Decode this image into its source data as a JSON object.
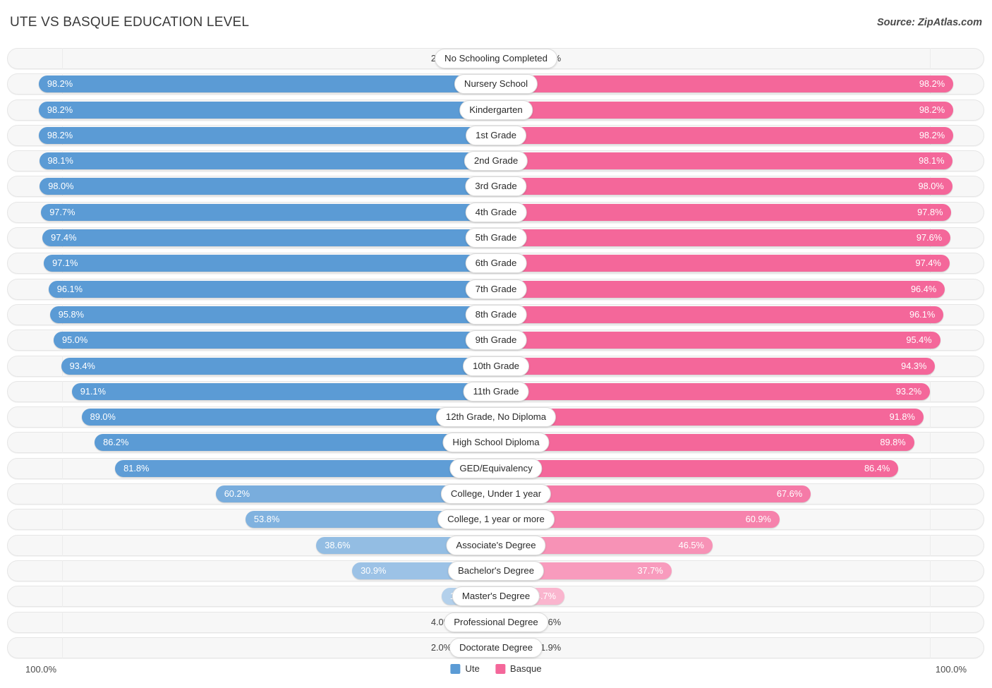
{
  "header": {
    "title": "UTE VS BASQUE EDUCATION LEVEL",
    "source": "Source: ZipAtlas.com"
  },
  "footer": {
    "axis_left": "100.0%",
    "axis_right": "100.0%",
    "legend": [
      {
        "label": "Ute",
        "color": "#5b9bd5"
      },
      {
        "label": "Basque",
        "color": "#f4679a"
      }
    ]
  },
  "colors": {
    "ute_strong": "#5b9bd5",
    "ute_light": "#b0cdee",
    "basque_strong": "#f4679a",
    "basque_light": "#f8aec8",
    "track_bg": "#f7f7f7",
    "track_border": "#e6e6e6"
  },
  "chart_data": {
    "type": "bar",
    "title": "UTE VS BASQUE EDUCATION LEVEL",
    "subtitle": "Source: ZipAtlas.com",
    "orientation": "horizontal-diverging",
    "xlabel": "",
    "ylabel": "",
    "xlim": [
      0,
      100
    ],
    "axis_left_label": "100.0%",
    "axis_right_label": "100.0%",
    "grid": false,
    "legend_position": "bottom-center",
    "categories": [
      "No Schooling Completed",
      "Nursery School",
      "Kindergarten",
      "1st Grade",
      "2nd Grade",
      "3rd Grade",
      "4th Grade",
      "5th Grade",
      "6th Grade",
      "7th Grade",
      "8th Grade",
      "9th Grade",
      "10th Grade",
      "11th Grade",
      "12th Grade, No Diploma",
      "High School Diploma",
      "GED/Equivalency",
      "College, Under 1 year",
      "College, 1 year or more",
      "Associate's Degree",
      "Bachelor's Degree",
      "Master's Degree",
      "Professional Degree",
      "Doctorate Degree"
    ],
    "series": [
      {
        "name": "Ute",
        "color": "#5b9bd5",
        "values": [
          2.3,
          98.2,
          98.2,
          98.2,
          98.1,
          98.0,
          97.7,
          97.4,
          97.1,
          96.1,
          95.8,
          95.0,
          93.4,
          91.1,
          89.0,
          86.2,
          81.8,
          60.2,
          53.8,
          38.6,
          30.9,
          11.7,
          4.0,
          2.0
        ],
        "labels": [
          "2.3%",
          "98.2%",
          "98.2%",
          "98.2%",
          "98.1%",
          "98.0%",
          "97.7%",
          "97.4%",
          "97.1%",
          "96.1%",
          "95.8%",
          "95.0%",
          "93.4%",
          "91.1%",
          "89.0%",
          "86.2%",
          "81.8%",
          "60.2%",
          "53.8%",
          "38.6%",
          "30.9%",
          "11.7%",
          "4.0%",
          "2.0%"
        ]
      },
      {
        "name": "Basque",
        "color": "#f4679a",
        "values": [
          1.8,
          98.2,
          98.2,
          98.2,
          98.1,
          98.0,
          97.8,
          97.6,
          97.4,
          96.4,
          96.1,
          95.4,
          94.3,
          93.2,
          91.8,
          89.8,
          86.4,
          67.6,
          60.9,
          46.5,
          37.7,
          14.7,
          4.6,
          1.9
        ],
        "labels": [
          "1.8%",
          "98.2%",
          "98.2%",
          "98.2%",
          "98.1%",
          "98.0%",
          "97.8%",
          "97.6%",
          "97.4%",
          "96.4%",
          "96.1%",
          "95.4%",
          "94.3%",
          "93.2%",
          "91.8%",
          "89.8%",
          "86.4%",
          "67.6%",
          "60.9%",
          "46.5%",
          "37.7%",
          "14.7%",
          "4.6%",
          "1.9%"
        ]
      }
    ]
  }
}
